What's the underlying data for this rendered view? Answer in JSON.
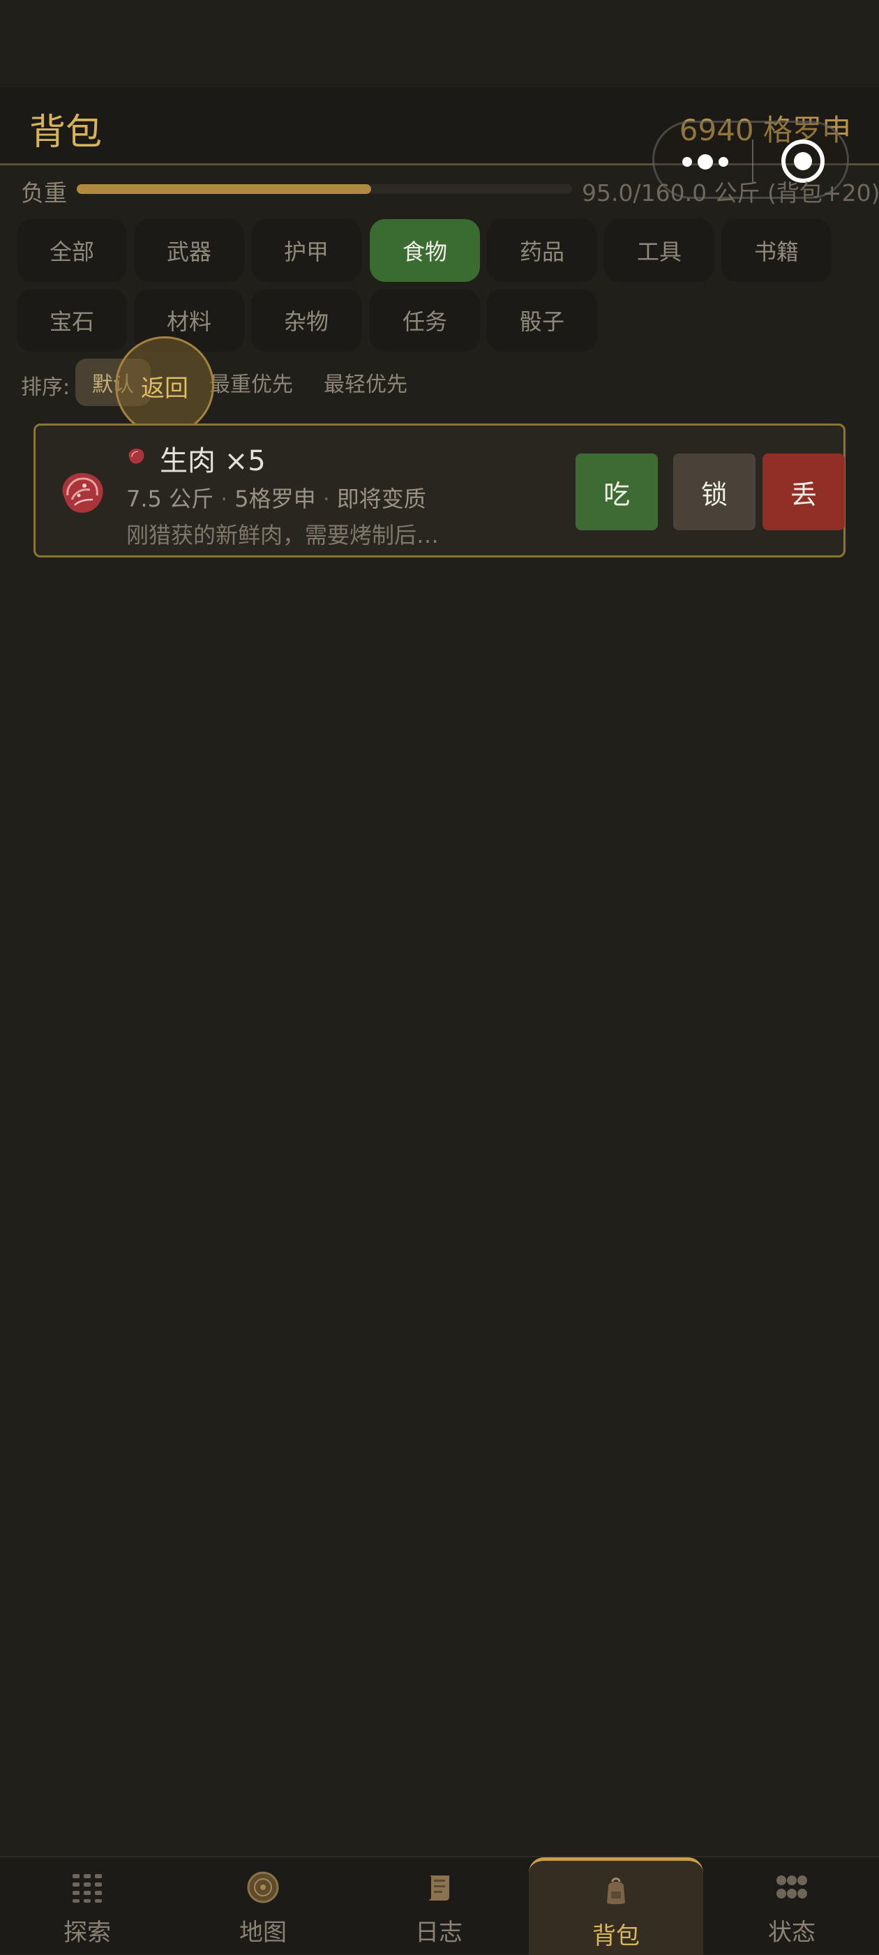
{
  "header": {
    "title": "背包",
    "money": "6940 格罗申"
  },
  "load": {
    "label": "负重",
    "text": "95.0/160.0 公斤 (背包+20)",
    "fill_fraction": 0.59375
  },
  "categories": [
    {
      "label": "全部"
    },
    {
      "label": "武器"
    },
    {
      "label": "护甲"
    },
    {
      "label": "食物",
      "active": true
    },
    {
      "label": "药品"
    },
    {
      "label": "工具"
    },
    {
      "label": "书籍"
    },
    {
      "label": "宝石"
    },
    {
      "label": "材料"
    },
    {
      "label": "杂物"
    },
    {
      "label": "任务"
    },
    {
      "label": "骰子"
    }
  ],
  "sort": {
    "label": "排序:",
    "options": [
      "默认",
      "最重优先",
      "最轻优先"
    ],
    "selected": "默认"
  },
  "back_bubble": "返回",
  "item": {
    "name": "生肉 ×5",
    "weight": "7.5 公斤",
    "price": "5格罗申",
    "status": "即将变质",
    "description": "刚猎获的新鲜肉，需要烤制后…",
    "actions": {
      "eat": "吃",
      "lock": "锁",
      "drop": "丢"
    }
  },
  "nav": [
    {
      "label": "探索",
      "icon": "explore-icon"
    },
    {
      "label": "地图",
      "icon": "map-icon"
    },
    {
      "label": "日志",
      "icon": "scroll-icon"
    },
    {
      "label": "背包",
      "icon": "backpack-icon",
      "active": true
    },
    {
      "label": "状态",
      "icon": "status-icon"
    }
  ],
  "colors": {
    "accent": "#d7b35a",
    "active_tab": "#3a6b30",
    "eat": "#3d6b33",
    "drop": "#8f2f25"
  }
}
